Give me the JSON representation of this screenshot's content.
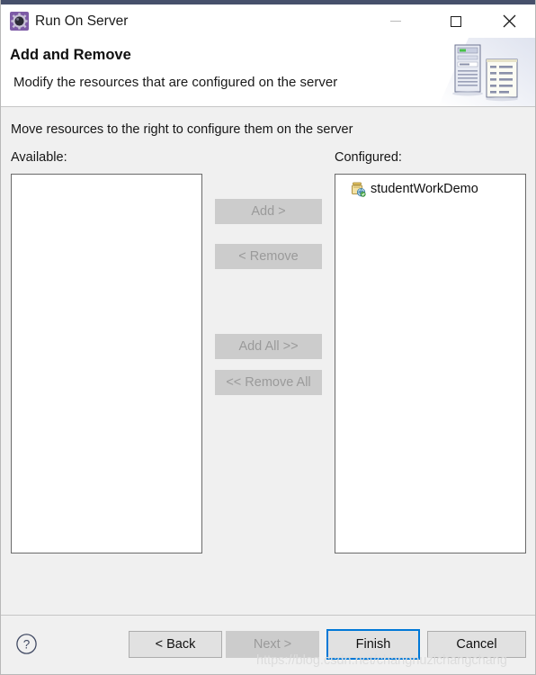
{
  "window": {
    "title": "Run On Server",
    "app_icon": "gear-icon",
    "accent_color": "#0078d7",
    "titlebar_strip_color": "#46506b",
    "controls": {
      "minimize": "minimize-icon",
      "maximize": "maximize-icon",
      "close": "close-icon"
    }
  },
  "header": {
    "title": "Add and Remove",
    "description": "Modify the resources that are configured on the server",
    "artwork": "server-and-document-icon"
  },
  "main": {
    "instruction": "Move resources to the right to configure them on the server",
    "available": {
      "label": "Available:",
      "items": []
    },
    "configured": {
      "label": "Configured:",
      "items": [
        {
          "label": "studentWorkDemo",
          "icon": "web-project-icon"
        }
      ]
    },
    "transfer_buttons": [
      {
        "label": "Add >",
        "enabled": false
      },
      {
        "label": "< Remove",
        "enabled": false
      },
      {
        "label": "Add All >>",
        "enabled": false
      },
      {
        "label": "<< Remove All",
        "enabled": false
      }
    ]
  },
  "footer": {
    "help_icon": "help-icon",
    "buttons": [
      {
        "label": "< Back",
        "enabled": true,
        "default": false
      },
      {
        "label": "Next >",
        "enabled": false,
        "default": false
      },
      {
        "label": "Finish",
        "enabled": true,
        "default": true
      },
      {
        "label": "Cancel",
        "enabled": true,
        "default": false
      }
    ]
  },
  "watermark": {
    "text": "https://blog.csdn.net/changhuzichangchang"
  }
}
